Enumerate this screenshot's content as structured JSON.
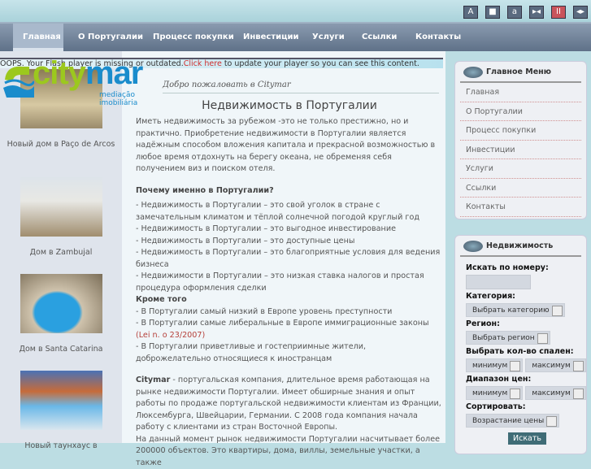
{
  "toolbar": {
    "buttons": [
      {
        "icon": "font-large-icon",
        "label": "A"
      },
      {
        "icon": "square-icon",
        "label": "■"
      },
      {
        "icon": "font-small-icon",
        "label": "a"
      },
      {
        "icon": "narrow-icon",
        "label": "▸◂"
      },
      {
        "icon": "pause-icon",
        "label": "II"
      },
      {
        "icon": "wide-icon",
        "label": "◂▸"
      }
    ]
  },
  "nav": [
    "Главная",
    "О Португалии",
    "Процесс покупки",
    "Инвестиции",
    "Услуги",
    "Ссылки",
    "Контакты"
  ],
  "flash": {
    "before": "OOPS. Your Flash player is missing or outdated.",
    "link": "Click here",
    "after": " to update your player so you can see this content."
  },
  "logo": {
    "word1": "city",
    "word2": "mar",
    "sub": "mediação imobiliária"
  },
  "welcome": "Добро пожаловать в Citymar",
  "main": {
    "title": "Недвижимость в Португалии",
    "intro": "Иметь недвижимость за рубежом -это не только престижно, но и практично. Приобретение недвижимости в Португалии является надёжным способом вложения капитала и прекрасной возможностью в любое время отдохнуть на берегу океана, не обременяя себя получением виз и поиском отеля.",
    "why": "Почему именно в Португалии?",
    "reasons": [
      "- Недвижимость в Португалии – это свой уголок в стране с замечательным  климатом и тёплой солнечной погодой круглый год",
      "- Недвижимость в Португалии – это выгодное инвестирование",
      "- Недвижимость в Португалии – это доступные цены",
      "- Недвижимость в Португалии – это благоприятные условия для ведения бизнеса",
      "- Недвижимости в Португалии – это низкая ставка налогов и простая процедура оформления сделки"
    ],
    "besides": "Кроме того",
    "extra": [
      "- В Португалии самый низкий в Европе уровень преступности",
      "- В Португалии самые либеральные в Европе иммиграционные законы"
    ],
    "law": "(Lei n. o 23/2007)",
    "extra2": "- В Португалии приветливые и гостеприимные жители,  доброжелательно относящиеся  к иностранцам",
    "company": "Citymar",
    "company_text": "  - португальская  компания, длительное время работающая на рынке недвижимости Португалии. Имеет  обширные знания и опыт работы по продаже португальской недвижимости клиентам из  Франции, Люксембурга, Швейцарии, Германии. С  2008 года компания начала работу с  клиентами из стран Восточной Европы.",
    "market": " На данный момент рынок недвижимости Португалии насчитывает более 200000 объектов. Это квартиры, дома, виллы, земельные участки, а также"
  },
  "properties": [
    {
      "caption": "Новый дом в Paço de Arcos"
    },
    {
      "caption": "Дом в Zambujal"
    },
    {
      "caption": "Дом в Santa Catarina"
    },
    {
      "caption": "Новый таунхаус в"
    }
  ],
  "menu": {
    "title": "Главное Меню",
    "items": [
      "Главная",
      "О Португалии",
      "Процесс покупки",
      "Инвестиции",
      "Услуги",
      "Ссылки",
      "Контакты"
    ]
  },
  "search": {
    "title": "Недвижимость",
    "by_number": "Искать по номеру:",
    "number_value": "",
    "category_label": "Категория:",
    "category": "Выбрать категорию",
    "region_label": "Регион:",
    "region": "Выбрать регион",
    "bedrooms_label": "Выбрать кол-во спален:",
    "min": "минимум",
    "max": "максимум",
    "price_label": "Диапазон цен:",
    "sort_label": "Сортировать:",
    "sort": "Возрастание цены",
    "submit": "Искать"
  }
}
